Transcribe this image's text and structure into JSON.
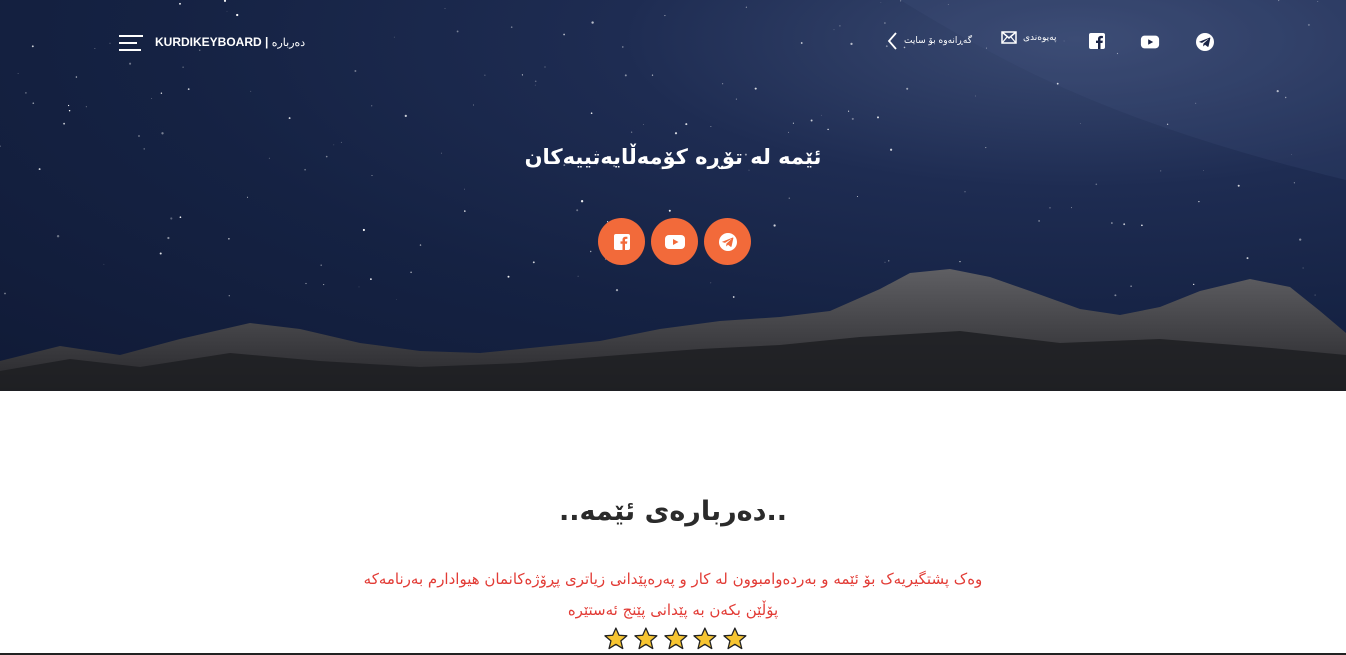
{
  "header": {
    "brand": "KURDIKEYBOARD |",
    "brand_sub": "دەربارە",
    "back_label": "گەڕانەوە بۆ سایت",
    "contact_label": "پەیوەندی",
    "icons": [
      "menu-icon",
      "chevron-left-icon",
      "mail-icon",
      "facebook-icon",
      "youtube-icon",
      "telegram-icon"
    ]
  },
  "hero": {
    "title": "ئێمە لە تۆڕە کۆمەڵایەتییەکان",
    "social_buttons": [
      "facebook",
      "youtube",
      "telegram"
    ],
    "accent_color": "#f26a3a"
  },
  "about": {
    "title": "..دەربارەی ئێمە..",
    "text_line1": "وەک پشتگیریەک بۆ ئێمە و بەردەوامبوون لە کار و پەرەپێدانی زیاتری پڕۆژەکانمان هیوادارم بەرنامەکە",
    "text_line2": "پۆڵێن بکەن بە پێدانی پێنج ئەستێرە",
    "text_color": "#e23b35",
    "rating": 5,
    "rating_max": 5
  }
}
